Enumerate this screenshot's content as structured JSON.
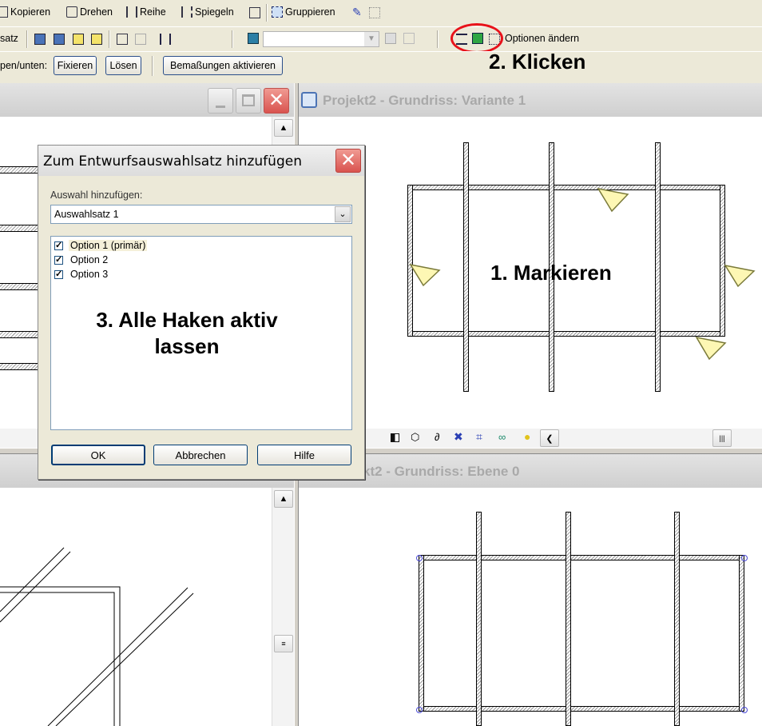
{
  "toolbar1": {
    "kopieren": "Kopieren",
    "drehen": "Drehen",
    "reihe": "Reihe",
    "spiegeln": "Spiegeln",
    "gruppieren": "Gruppieren"
  },
  "toolbar2": {
    "satz_fragment": "satz",
    "optionen_aendern": "Optionen ändern"
  },
  "toolbar3": {
    "label_fragment": "pen/unten:",
    "fixieren": "Fixieren",
    "loesen": "Lösen",
    "bemassungen": "Bemaßungen aktivieren"
  },
  "views": {
    "top_right_title": "Projekt2 - Grundriss: Variante 1",
    "bottom_right_title": "kt2 - Grundriss: Ebene 0"
  },
  "dialog": {
    "title": "Zum Entwurfsauswahlsatz hinzufügen",
    "add_label": "Auswahl hinzufügen:",
    "select_value": "Auswahlsatz 1",
    "options": [
      "Option 1 (primär)",
      "Option 2",
      "Option 3"
    ],
    "ok": "OK",
    "cancel": "Abbrechen",
    "help": "Hilfe"
  },
  "annotations": {
    "step1": "1. Markieren",
    "step2": "2. Klicken",
    "step3_line1": "3. Alle Haken aktiv",
    "step3_line2": "lassen"
  },
  "colors": {
    "highlight_ellipse": "#e8121a",
    "title_text": "#a9a9a9",
    "close_red": "#d9534f",
    "flag_yellow": "#fdf7b4"
  }
}
